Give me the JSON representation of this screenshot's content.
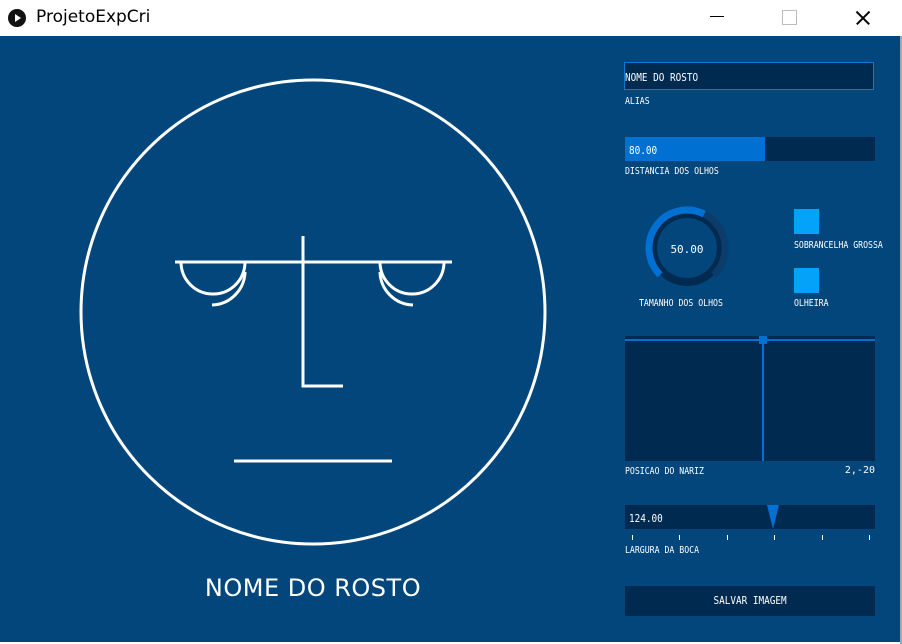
{
  "window": {
    "title": "ProjetoExpCri",
    "minimize_icon": "minimize-icon",
    "maximize_icon": "maximize-icon",
    "close_icon": "close-icon"
  },
  "face": {
    "name": "NOME DO ROSTO",
    "stroke_color": "#ffffff",
    "background_color": "#02467b"
  },
  "controls": {
    "alias": {
      "value": "NOME DO ROSTO",
      "label": "ALIAS"
    },
    "eye_distance": {
      "value": "80.00",
      "fill_fraction": 0.56,
      "label": "DISTANCIA DOS OLHOS"
    },
    "eye_size": {
      "value": "50.00",
      "fill_fraction": 0.6,
      "label": "TAMANHO DOS OLHOS"
    },
    "thick_eyebrow": {
      "label": "SOBRANCELHA GROSSA",
      "on": true
    },
    "dark_circles": {
      "label": "OLHEIRA",
      "on": true
    },
    "nose_position": {
      "label": "POSICAO DO NARIZ",
      "value": "2,-20",
      "x": 2,
      "y": -20
    },
    "mouth_width": {
      "value": "124.00",
      "label": "LARGURA DA BOCA"
    },
    "save_button": {
      "label": "SALVAR IMAGEM"
    }
  },
  "colors": {
    "accent": "#0070d2",
    "control_bg": "#012a50",
    "toggle_on": "#04a2f8"
  }
}
